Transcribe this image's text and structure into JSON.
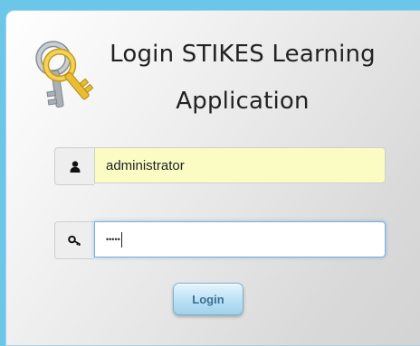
{
  "title": {
    "line1": "Login STIKES Learning",
    "line2": "Application"
  },
  "username": {
    "icon": "user-icon",
    "value": "administrator"
  },
  "password": {
    "icon": "key-icon",
    "masked_value": "•••••"
  },
  "login_button": {
    "label": "Login"
  },
  "colors": {
    "page_background": "#6cc6ea",
    "username_background": "#fafcc4",
    "button_text": "#3a6f96",
    "focus_border": "#79b0e0"
  }
}
